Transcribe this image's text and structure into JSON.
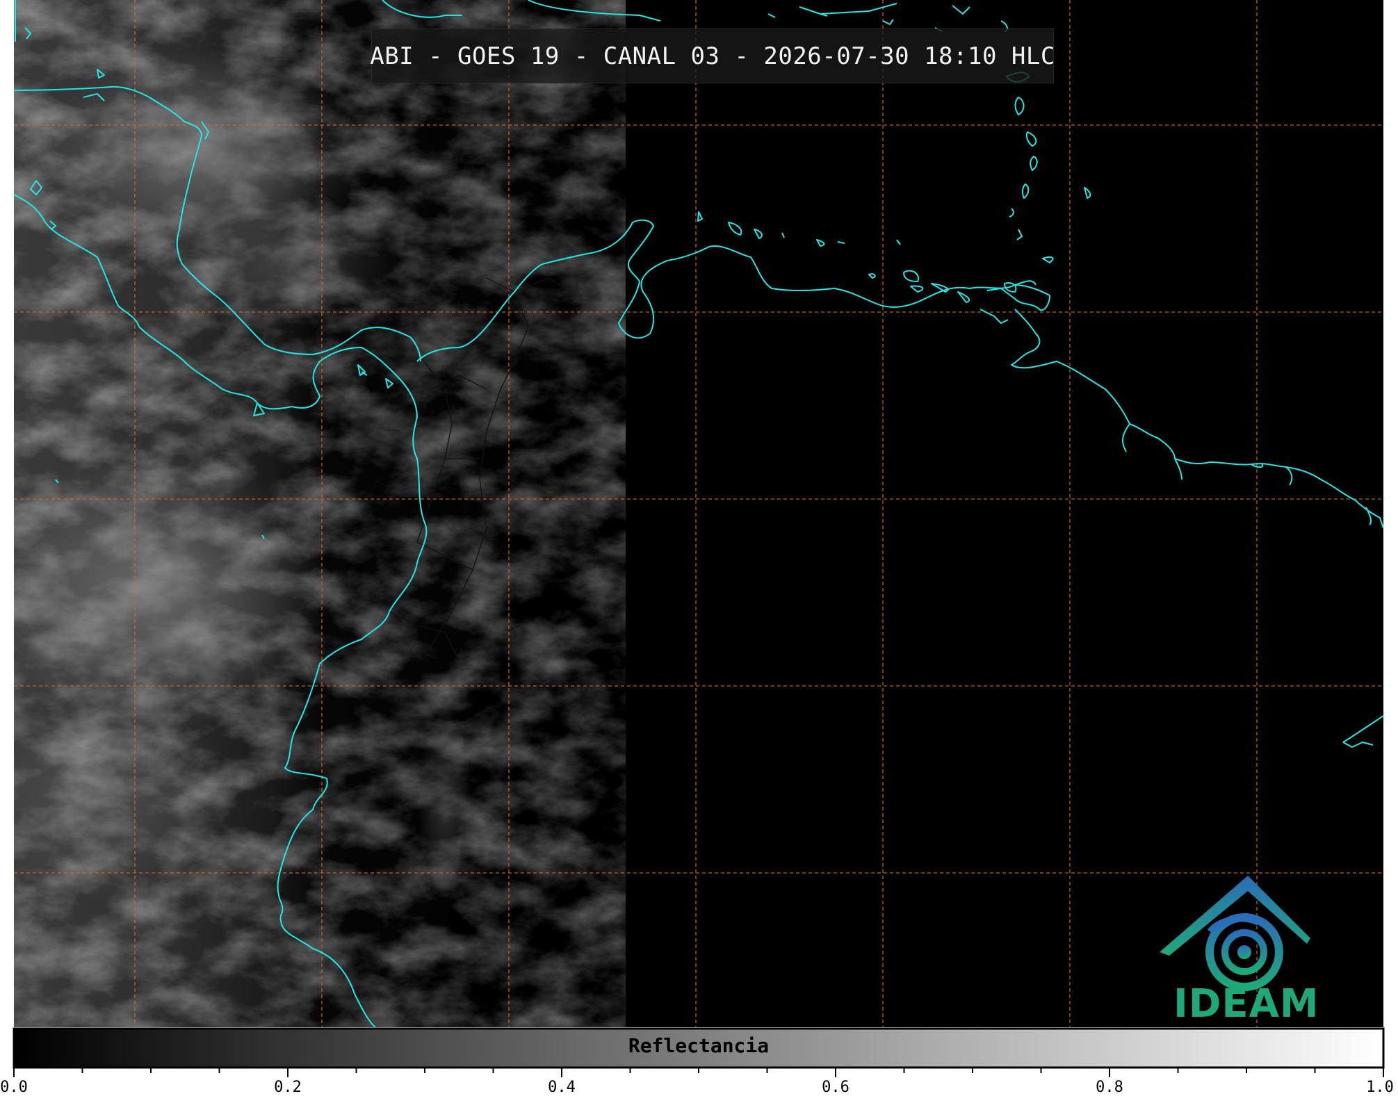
{
  "title": "ABI - GOES 19 - CANAL 03 - 2026-07-30 18:10 HLC",
  "colorbar": {
    "label": "Reflectancia",
    "ticks": [
      "0.0",
      "0.2",
      "0.4",
      "0.6",
      "0.8",
      "1.0"
    ],
    "range": [
      0.0,
      1.0
    ],
    "colormap": "grayscale",
    "color_min": "#000000",
    "color_max": "#ffffff"
  },
  "map": {
    "coastline_color": "#23e6e6",
    "gridline_color": "#d2691e",
    "gridline_style": "dashed",
    "border_color": "#000000"
  },
  "logo": {
    "text": "IDEAM",
    "colors": [
      "#2a6db8",
      "#1fa97a"
    ]
  }
}
